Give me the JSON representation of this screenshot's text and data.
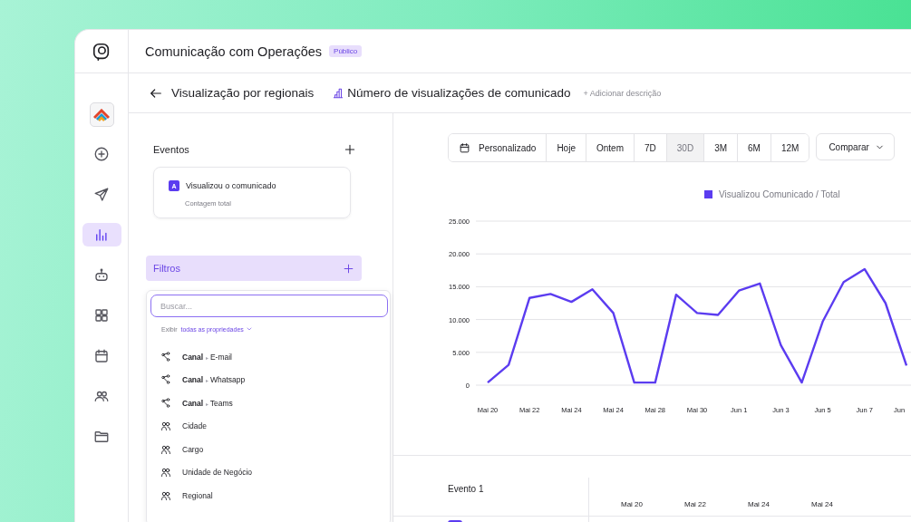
{
  "app": {
    "title": "Comunicação com Operações",
    "badge": "Público"
  },
  "sidebar": {
    "items": [
      {
        "selected": false
      },
      {
        "selected": false
      },
      {
        "selected": true
      },
      {
        "selected": false
      },
      {
        "selected": false
      },
      {
        "selected": false
      },
      {
        "selected": false
      },
      {
        "selected": false
      }
    ]
  },
  "toolbar": {
    "title": "Visualização por regionais",
    "metric": "Número de visualizações de comunicado",
    "add_description": "+ Adicionar descrição"
  },
  "events": {
    "title": "Eventos",
    "items": [
      {
        "badge": "A",
        "name": "Visualizou o comunicado",
        "aggregation": "Contagem total"
      }
    ]
  },
  "filters": {
    "title": "Filtros",
    "search": {
      "placeholder": "Buscar..."
    },
    "show_label": "Exibir",
    "show_value": "todas as propriedades",
    "properties": [
      {
        "kind": "channel",
        "parent": "Canal",
        "separator": "▸",
        "name": "E-mail"
      },
      {
        "kind": "channel",
        "parent": "Canal",
        "separator": "▸",
        "name": "Whatsapp"
      },
      {
        "kind": "channel",
        "parent": "Canal",
        "separator": "▸",
        "name": "Teams"
      },
      {
        "kind": "attribute",
        "name": "Cidade"
      },
      {
        "kind": "attribute",
        "name": "Cargo"
      },
      {
        "kind": "attribute",
        "name": "Unidade de Negócio"
      },
      {
        "kind": "attribute",
        "name": "Regional"
      }
    ]
  },
  "ranges": [
    {
      "label": "Personalizado",
      "selected": false
    },
    {
      "label": "Hoje",
      "selected": false
    },
    {
      "label": "Ontem",
      "selected": false
    },
    {
      "label": "7D",
      "selected": false
    },
    {
      "label": "30D",
      "selected": true
    },
    {
      "label": "3M",
      "selected": false
    },
    {
      "label": "6M",
      "selected": false
    },
    {
      "label": "12M",
      "selected": false
    }
  ],
  "compare": "Comparar",
  "chart": {
    "chart_data": {
      "type": "line",
      "categories": [
        "Mai 20",
        null,
        "Mai 22",
        null,
        "Mai 24",
        null,
        "Mai 24",
        null,
        "Mai 28",
        null,
        "Mai 30",
        null,
        "Jun 1",
        null,
        "Jun 3",
        null,
        "Jun 5",
        null,
        "Jun 7",
        null,
        "Jun"
      ],
      "series": [
        {
          "name": "Visualizou Comunicado / Total",
          "color": "#5b3cf0",
          "values": [
            400,
            3100,
            13300,
            13900,
            12700,
            14600,
            11000,
            400,
            400,
            13800,
            11000,
            10700,
            14400,
            15500,
            6100,
            400,
            9700,
            15700,
            17700,
            12500,
            3000
          ]
        }
      ],
      "grid": true,
      "ylim": [
        0,
        25000
      ],
      "yticks": [
        {
          "value": 0,
          "label": "0"
        },
        {
          "value": 5000,
          "label": "5.000"
        },
        {
          "value": 10000,
          "label": "10.000"
        },
        {
          "value": 15000,
          "label": "15.000"
        },
        {
          "value": 20000,
          "label": "20.000"
        },
        {
          "value": 25000,
          "label": "25.000"
        }
      ]
    }
  },
  "table": {
    "title": "Evento 1",
    "columns": [
      "Mai 20",
      "Mai 22",
      "Mai 24",
      "Mai 24"
    ],
    "rows": [
      {
        "color": "#5b3cf0"
      }
    ]
  }
}
